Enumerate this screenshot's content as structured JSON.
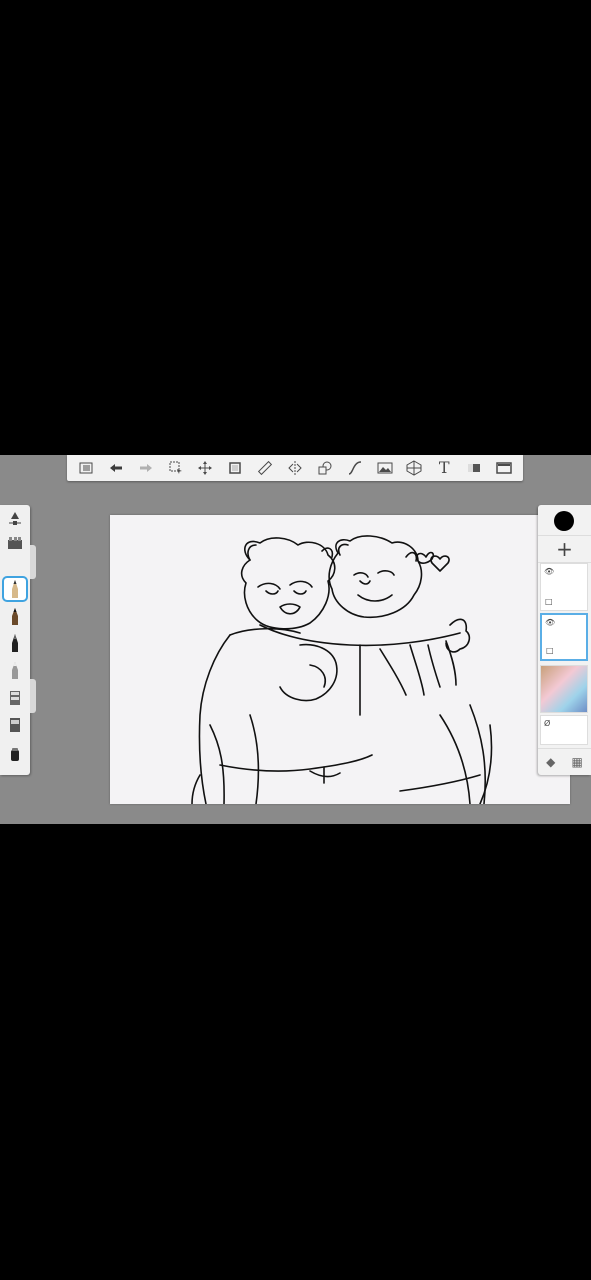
{
  "toolbar": {
    "items": [
      {
        "name": "list-icon"
      },
      {
        "name": "undo-icon"
      },
      {
        "name": "redo-icon"
      },
      {
        "name": "select-icon"
      },
      {
        "name": "transform-icon"
      },
      {
        "name": "crop-icon"
      },
      {
        "name": "ruler-icon"
      },
      {
        "name": "symmetry-icon"
      },
      {
        "name": "shapes-icon"
      },
      {
        "name": "curve-icon"
      },
      {
        "name": "image-icon"
      },
      {
        "name": "perspective-icon"
      },
      {
        "name": "text-icon",
        "label": "T"
      },
      {
        "name": "fill-icon"
      },
      {
        "name": "fullscreen-icon"
      }
    ]
  },
  "layers": {
    "add_label": "+",
    "color": "#000000",
    "accent": "#5aaee6"
  }
}
